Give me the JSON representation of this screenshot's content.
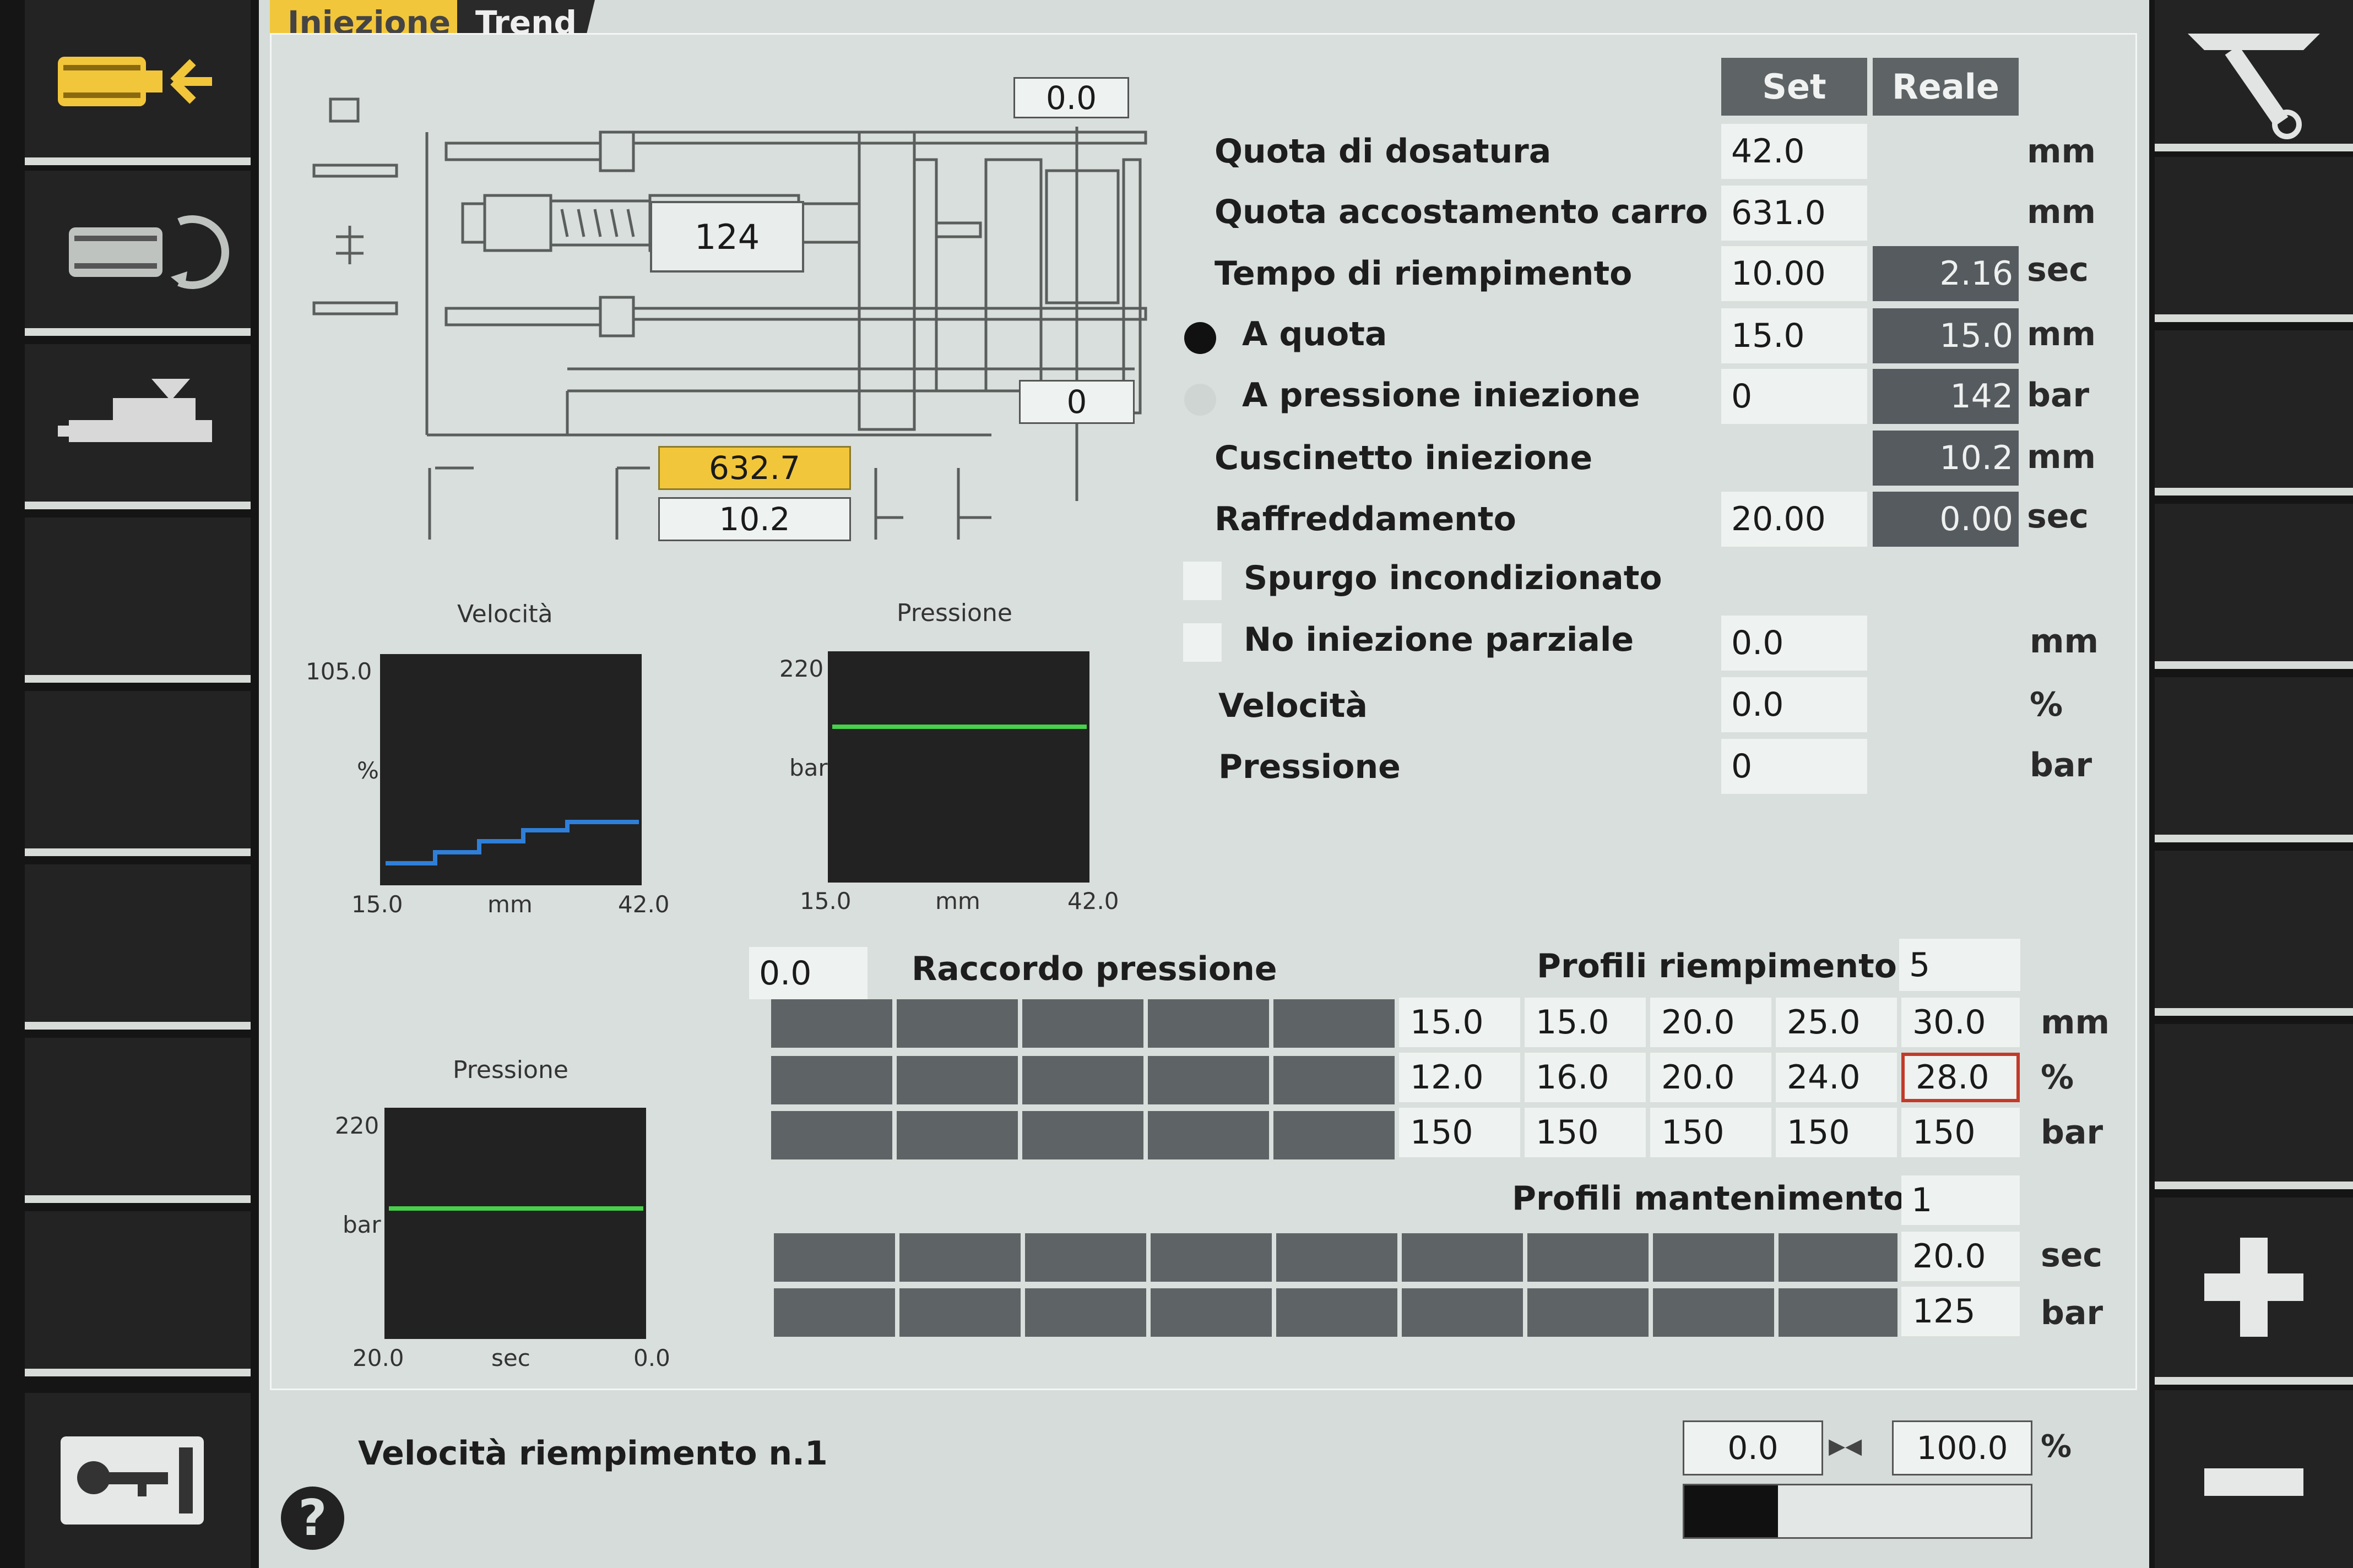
{
  "tabs": [
    {
      "label": "Iniezione",
      "active": true
    },
    {
      "label": "Trend",
      "active": false
    }
  ],
  "machine": {
    "top_value": "0.0",
    "screw_value": "124",
    "bottom_value": "0",
    "carriage_position": "632.7",
    "cushion": "10.2"
  },
  "columns": {
    "set": "Set",
    "actual": "Reale"
  },
  "params": [
    {
      "label": "Quota di dosatura",
      "set": "42.0",
      "actual": "",
      "unit": "mm"
    },
    {
      "label": "Quota accostamento carro",
      "set": "631.0",
      "actual": "",
      "unit": "mm"
    },
    {
      "label": "Tempo di riempimento",
      "set": "10.00",
      "actual": "2.16",
      "unit": "sec"
    },
    {
      "label": "A quota",
      "set": "15.0",
      "actual": "15.0",
      "unit": "mm"
    },
    {
      "label": "A pressione iniezione",
      "set": "0",
      "actual": "142",
      "unit": "bar"
    },
    {
      "label": "Cuscinetto iniezione",
      "set": "",
      "actual": "10.2",
      "unit": "mm"
    },
    {
      "label": "Raffreddamento",
      "set": "20.00",
      "actual": "0.00",
      "unit": "sec"
    },
    {
      "label": "Spurgo incondizionato"
    },
    {
      "label": "No iniezione parziale",
      "set": "0.0",
      "unit": "mm"
    },
    {
      "label": "Velocità",
      "set": "0.0",
      "unit": "%"
    },
    {
      "label": "Pressione",
      "set": "0",
      "unit": "bar"
    }
  ],
  "charts": {
    "speed": {
      "title": "Velocità",
      "ymax": "105.0",
      "yunit": "%",
      "xmin": "15.0",
      "xunit": "mm",
      "xmax": "42.0"
    },
    "pressure": {
      "title": "Pressione",
      "ymax": "220",
      "yunit": "bar",
      "xmin": "15.0",
      "xunit": "mm",
      "xmax": "42.0"
    },
    "hold_pressure": {
      "title": "Pressione",
      "ymax": "220",
      "yunit": "bar",
      "xmin": "20.0",
      "xunit": "sec",
      "xmax": "0.0"
    }
  },
  "fill_profiles": {
    "raccordo_value": "0.0",
    "raccordo_label": "Raccordo pressione",
    "title": "Profili riempimento",
    "count": "5",
    "positions": [
      "15.0",
      "15.0",
      "20.0",
      "25.0",
      "30.0"
    ],
    "speeds": [
      "12.0",
      "16.0",
      "20.0",
      "24.0",
      "28.0"
    ],
    "pressures": [
      "150",
      "150",
      "150",
      "150",
      "150"
    ],
    "units": [
      "mm",
      "%",
      "bar"
    ]
  },
  "hold_profiles": {
    "title": "Profili mantenimento",
    "count": "1",
    "time": "20.0",
    "pressure": "125",
    "units": [
      "sec",
      "bar"
    ]
  },
  "status": {
    "label": "Velocità riempimento n.1",
    "min": "0.0",
    "max": "100.0",
    "unit": "%",
    "level_fraction": 0.27
  },
  "icons": {
    "left": [
      "injection-unit-back-icon",
      "screw-rotate-icon",
      "carriage-icon",
      "",
      "",
      "",
      "",
      "",
      "key-card-icon"
    ],
    "right": [
      "tools-icon",
      "",
      "",
      "",
      "",
      "",
      "",
      "plus-icon",
      "minus-icon"
    ],
    "help": "help-icon"
  },
  "colors": {
    "accent_yellow": "#f2c63a",
    "curve_blue": "#2f7fd8",
    "curve_green": "#47d14a",
    "actual_cell": "#555b5e"
  }
}
